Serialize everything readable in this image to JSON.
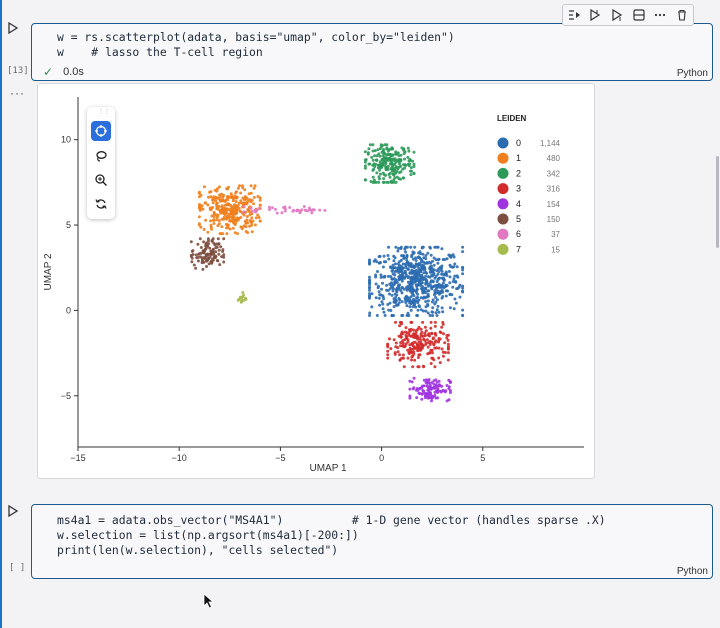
{
  "cell1": {
    "exec_count": "[13]",
    "lines": [
      "w = rs.scatterplot(adata, basis=\"umap\", color_by=\"leiden\")",
      "w    # lasso the T-cell region"
    ],
    "status_time": "0.0s",
    "language": "Python"
  },
  "cell2": {
    "exec_count": "[ ]",
    "lines": [
      "ms4a1 = adata.obs_vector(\"MS4A1\")          # 1-D gene vector (handles sparse .X)",
      "w.selection = list(np.argsort(ms4a1)[-200:])",
      "print(len(w.selection), \"cells selected\")"
    ],
    "language": "Python"
  },
  "output_more": "···",
  "toolbar": {
    "icons": [
      "run-by-line-icon",
      "execute-above-icon",
      "execute-below-icon",
      "split-cell-icon",
      "more-icon",
      "delete-icon"
    ]
  },
  "plot_tools": [
    "pan-icon",
    "lasso-icon",
    "zoom-icon",
    "reset-icon"
  ],
  "chart_data": {
    "type": "scatter",
    "xlabel": "UMAP 1",
    "ylabel": "UMAP 2",
    "xlim": [
      -15,
      10
    ],
    "ylim": [
      -8,
      12.5
    ],
    "xticks": [
      -15,
      -10,
      -5,
      0,
      5
    ],
    "yticks": [
      -5,
      0,
      5,
      10
    ],
    "grid": false,
    "legend_title": "LEIDEN",
    "legend_position": "top-right",
    "series": [
      {
        "name": "0",
        "count": "1,144",
        "color": "#2b6cb0",
        "center": [
          1.7,
          1.7
        ],
        "spread": [
          2.3,
          2.0
        ],
        "n": 650
      },
      {
        "name": "1",
        "count": "480",
        "color": "#f07f1e",
        "center": [
          -7.5,
          5.9
        ],
        "spread": [
          1.5,
          1.4
        ],
        "n": 300
      },
      {
        "name": "2",
        "count": "342",
        "color": "#2e9a5a",
        "center": [
          0.4,
          8.6
        ],
        "spread": [
          1.2,
          1.1
        ],
        "n": 230
      },
      {
        "name": "3",
        "count": "316",
        "color": "#d22b2b",
        "center": [
          1.8,
          -2.0
        ],
        "spread": [
          1.5,
          1.3
        ],
        "n": 220
      },
      {
        "name": "4",
        "count": "154",
        "color": "#a034e0",
        "center": [
          2.4,
          -4.6
        ],
        "spread": [
          1.0,
          0.7
        ],
        "n": 110
      },
      {
        "name": "5",
        "count": "150",
        "color": "#7d4f40",
        "center": [
          -8.6,
          3.3
        ],
        "spread": [
          0.8,
          0.9
        ],
        "n": 110
      },
      {
        "name": "6",
        "count": "37",
        "color": "#e078c2",
        "center": [
          -4.8,
          5.9
        ],
        "spread": [
          2.0,
          0.2
        ],
        "n": 40
      },
      {
        "name": "7",
        "count": "15",
        "color": "#a6bb4e",
        "center": [
          -6.9,
          0.7
        ],
        "spread": [
          0.2,
          0.35
        ],
        "n": 15
      }
    ]
  }
}
